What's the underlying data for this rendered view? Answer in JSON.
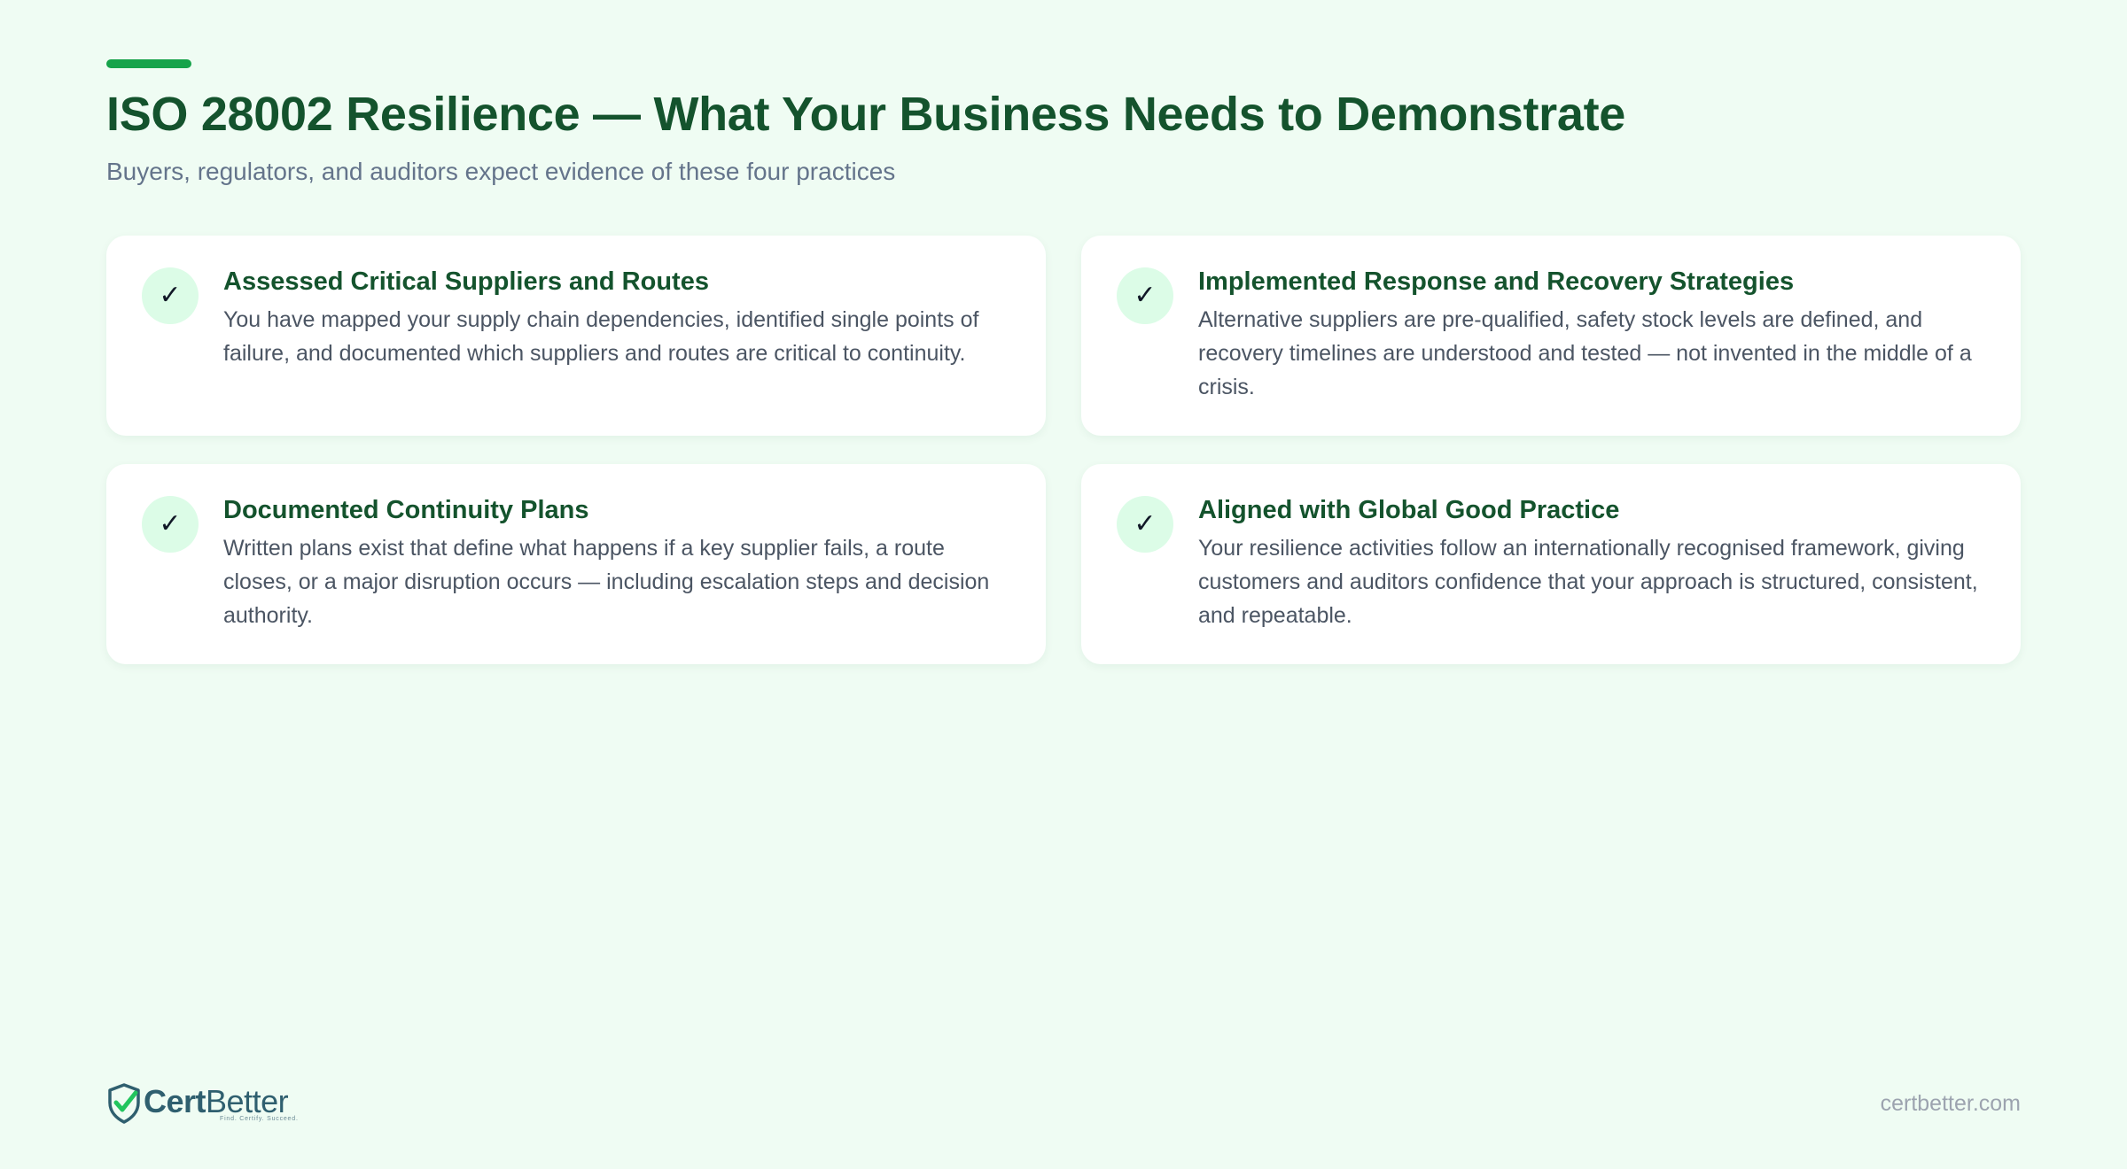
{
  "header": {
    "title": "ISO 28002 Resilience — What Your Business Needs to Demonstrate",
    "subtitle": "Buyers, regulators, and auditors expect evidence of these four practices"
  },
  "cards": [
    {
      "icon": "check-icon",
      "glyph": "✓",
      "title": "Assessed Critical Suppliers and Routes",
      "body": "You have mapped your supply chain dependencies, identified single points of failure, and documented which suppliers and routes are critical to continuity."
    },
    {
      "icon": "check-icon",
      "glyph": "✓",
      "title": "Implemented Response and Recovery Strategies",
      "body": "Alternative suppliers are pre-qualified, safety stock levels are defined, and recovery timelines are understood and tested — not invented in the middle of a crisis."
    },
    {
      "icon": "check-icon",
      "glyph": "✓",
      "title": "Documented Continuity Plans",
      "body": "Written plans exist that define what happens if a key supplier fails, a route closes, or a major disruption occurs — including escalation steps and decision authority."
    },
    {
      "icon": "check-icon",
      "glyph": "✓",
      "title": "Aligned with Global Good Practice",
      "body": "Your resilience activities follow an internationally recognised framework, giving customers and auditors confidence that your approach is structured, consistent, and repeatable."
    }
  ],
  "footer": {
    "logo": {
      "word_bold": "Cert",
      "word_regular": "Better",
      "tagline": "Find. Certify. Succeed."
    },
    "url": "certbetter.com"
  },
  "colors": {
    "background": "#effcf3",
    "accent": "#16a34a",
    "title": "#14532d",
    "subtitle": "#64748b",
    "card_bg": "#ffffff",
    "check_circle": "#dcfce7",
    "logo": "#2f5f6f"
  }
}
